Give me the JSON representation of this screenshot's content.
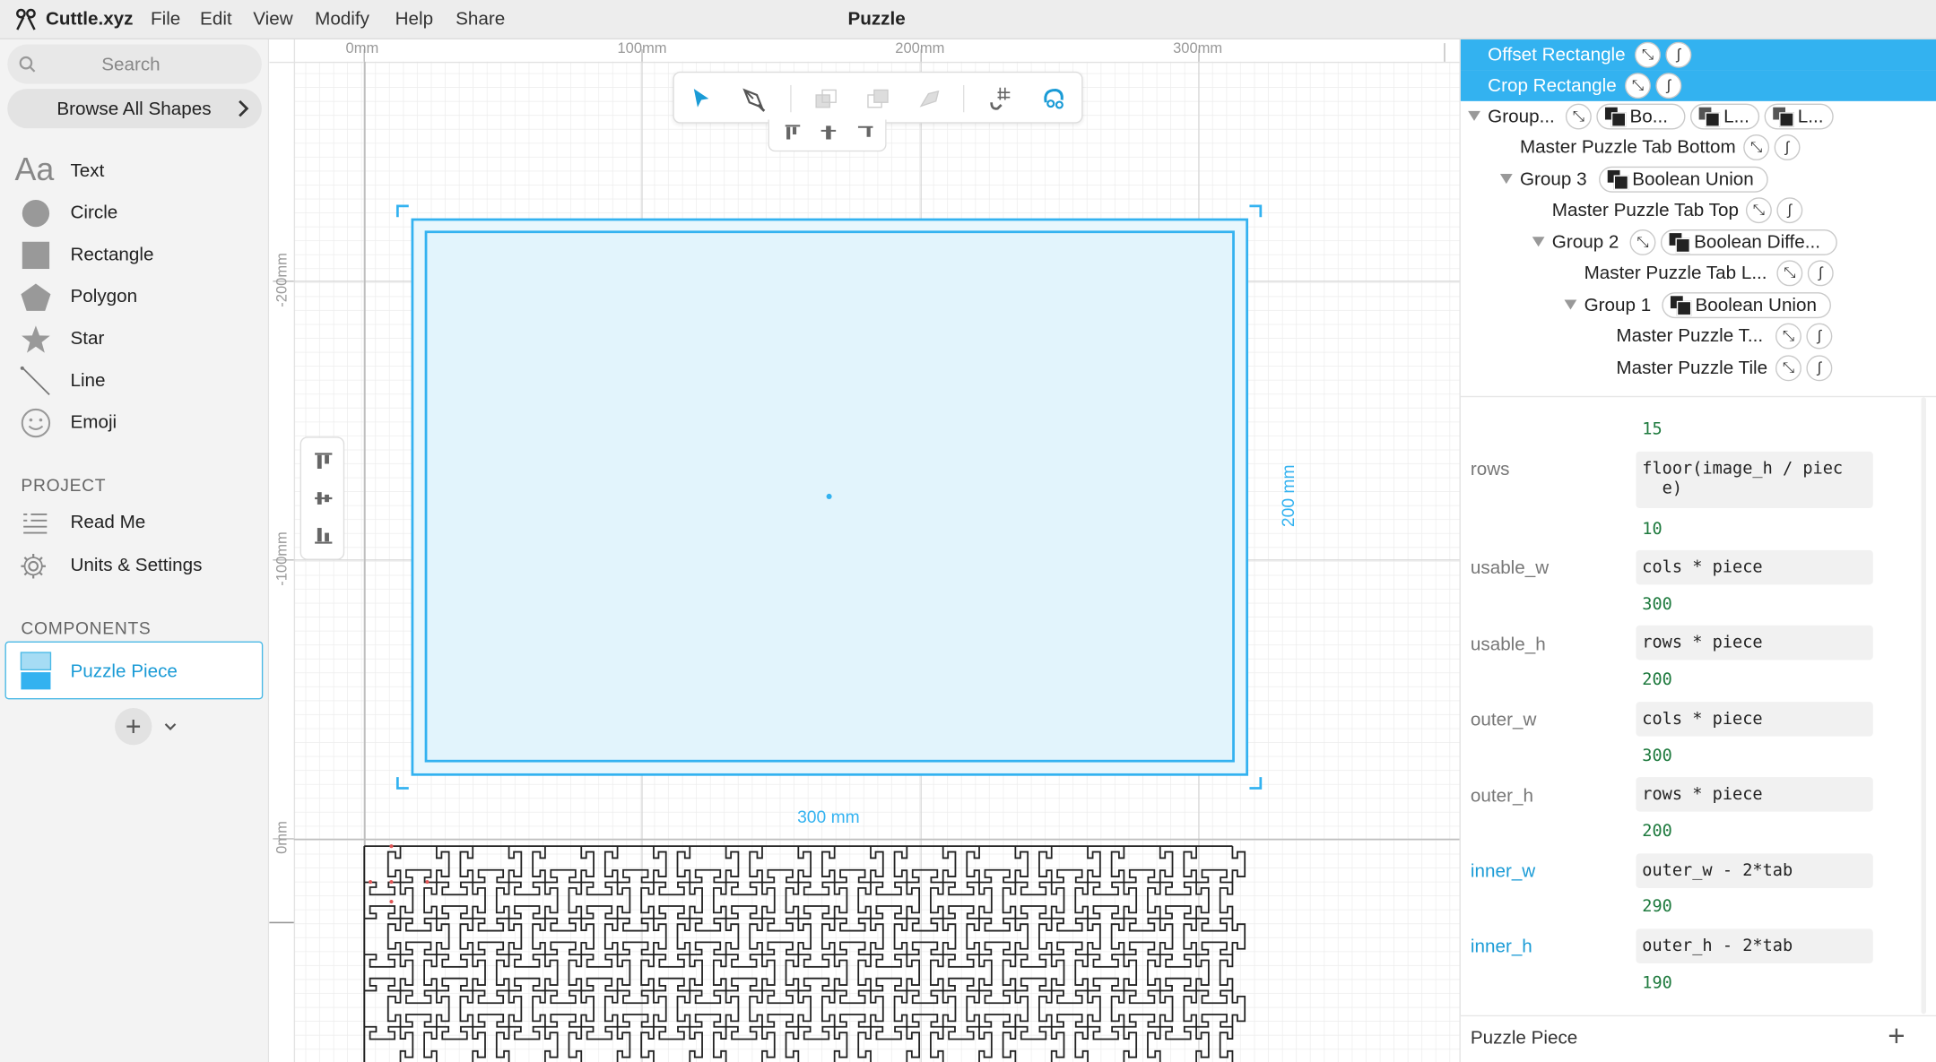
{
  "app": {
    "name": "Cuttle.xyz",
    "doc_title": "Puzzle"
  },
  "menu": [
    "File",
    "Edit",
    "View",
    "Modify",
    "Help",
    "Share"
  ],
  "sidebar": {
    "search_placeholder": "Search",
    "browse_label": "Browse All Shapes",
    "shapes": [
      {
        "label": "Text",
        "icon": "text-icon"
      },
      {
        "label": "Circle",
        "icon": "circle-icon"
      },
      {
        "label": "Rectangle",
        "icon": "rectangle-icon"
      },
      {
        "label": "Polygon",
        "icon": "polygon-icon"
      },
      {
        "label": "Star",
        "icon": "star-icon"
      },
      {
        "label": "Line",
        "icon": "line-icon"
      },
      {
        "label": "Emoji",
        "icon": "emoji-icon"
      }
    ],
    "project_title": "PROJECT",
    "project_items": [
      {
        "label": "Read Me",
        "icon": "readme-icon"
      },
      {
        "label": "Units & Settings",
        "icon": "gear-icon"
      }
    ],
    "components_title": "COMPONENTS",
    "component": "Puzzle Piece"
  },
  "canvas": {
    "ruler_x": [
      "0mm",
      "100mm",
      "200mm",
      "300mm"
    ],
    "ruler_y": [
      "-200mm",
      "-100mm",
      "0mm"
    ],
    "dim_width": "300 mm",
    "dim_height": "200 mm",
    "text_glyph": "Aa",
    "colors": {
      "accent": "#33b2f0",
      "fill": "#e8f7fd",
      "grid": "#ececec"
    }
  },
  "layers": [
    {
      "label": "Offset Rectangle",
      "selected": true
    },
    {
      "label": "Crop Rectangle",
      "selected": true
    },
    {
      "label": "Group...",
      "pills": [
        "Bo...",
        "L...",
        "L..."
      ]
    },
    {
      "label": "Master Puzzle Tab Bottom"
    },
    {
      "label": "Group 3",
      "pill": "Boolean Union"
    },
    {
      "label": "Master Puzzle Tab Top"
    },
    {
      "label": "Group 2",
      "pill": "Boolean Diffe..."
    },
    {
      "label": "Master Puzzle Tab L..."
    },
    {
      "label": "Group 1",
      "pill": "Boolean Union"
    },
    {
      "label": "Master Puzzle T..."
    },
    {
      "label": "Master Puzzle Tile"
    }
  ],
  "params": {
    "top_value": "15",
    "items": [
      {
        "name": "rows",
        "expr": "floor(image_h / piec\n  e)",
        "value": "10",
        "highlight": false
      },
      {
        "name": "usable_w",
        "expr": "cols * piece",
        "value": "300",
        "highlight": false
      },
      {
        "name": "usable_h",
        "expr": "rows * piece",
        "value": "200",
        "highlight": false
      },
      {
        "name": "outer_w",
        "expr": "cols * piece",
        "value": "300",
        "highlight": false
      },
      {
        "name": "outer_h",
        "expr": "rows * piece",
        "value": "200",
        "highlight": false
      },
      {
        "name": "inner_w",
        "expr": "outer_w - 2*tab",
        "value": "290",
        "highlight": true
      },
      {
        "name": "inner_h",
        "expr": "outer_h - 2*tab",
        "value": "190",
        "highlight": true
      }
    ]
  },
  "footer": {
    "label": "Puzzle Piece"
  }
}
